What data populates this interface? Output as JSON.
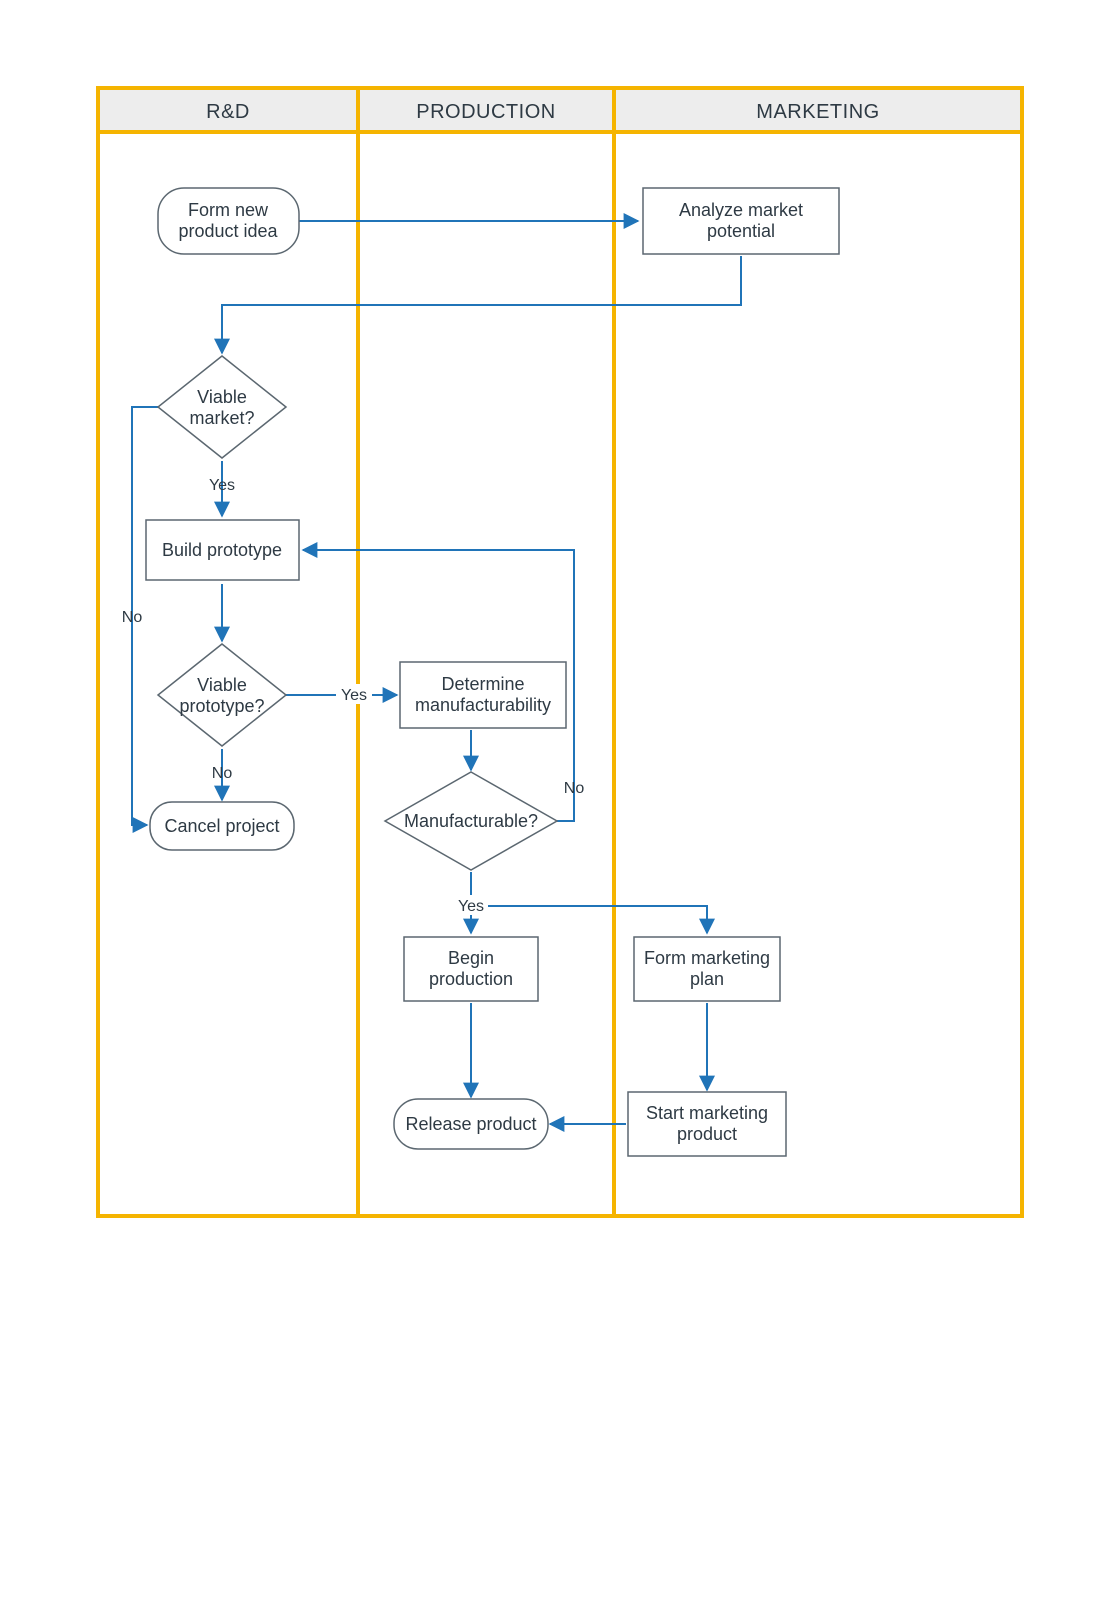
{
  "swimlanes": {
    "rd": {
      "header": "R&D"
    },
    "production": {
      "header": "PRODUCTION"
    },
    "marketing": {
      "header": "MARKETING"
    }
  },
  "nodes": {
    "form_idea": {
      "line1": "Form new",
      "line2": "product idea"
    },
    "analyze_market": {
      "line1": "Analyze market",
      "line2": "potential"
    },
    "viable_market": {
      "line1": "Viable",
      "line2": "market?"
    },
    "build_prototype": {
      "line1": "Build prototype"
    },
    "viable_prototype": {
      "line1": "Viable",
      "line2": "prototype?"
    },
    "cancel_project": {
      "line1": "Cancel project"
    },
    "determine_mfg": {
      "line1": "Determine",
      "line2": "manufacturability"
    },
    "manufacturable": {
      "line1": "Manufacturable?"
    },
    "begin_production": {
      "line1": "Begin",
      "line2": "production"
    },
    "form_marketing": {
      "line1": "Form marketing",
      "line2": "plan"
    },
    "release_product": {
      "line1": "Release product"
    },
    "start_marketing": {
      "line1": "Start marketing",
      "line2": "product"
    }
  },
  "labels": {
    "yes": "Yes",
    "no": "No"
  },
  "colors": {
    "lane_border": "#F5B400",
    "lane_header_bg": "#EDEDED",
    "node_stroke": "#5B6770",
    "connector": "#2074B8",
    "text": "#2e3a44"
  }
}
